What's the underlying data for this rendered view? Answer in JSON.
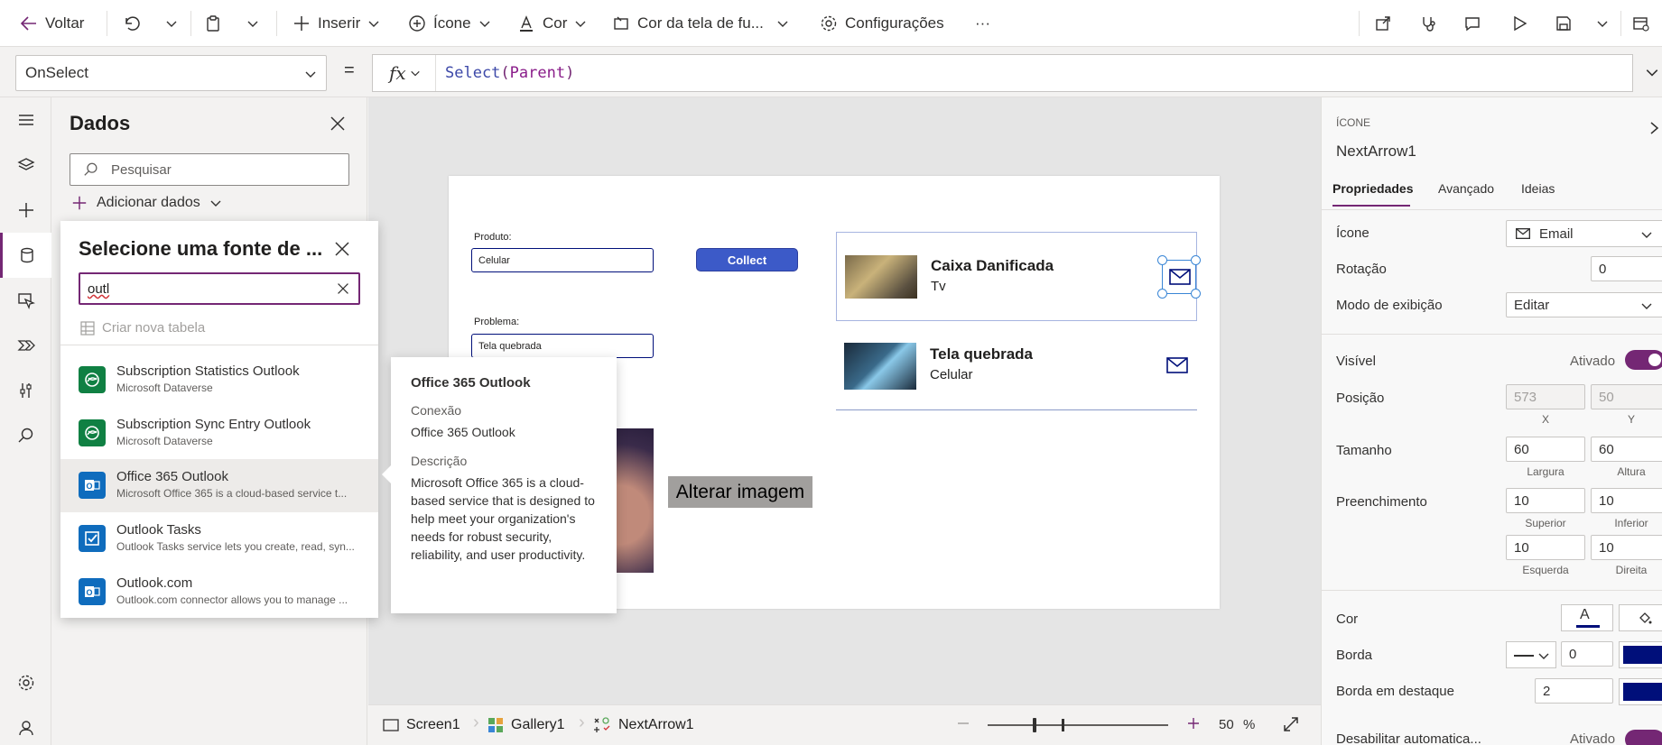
{
  "toolbar": {
    "back": "Voltar",
    "insert": "Inserir",
    "icon": "Ícone",
    "color": "Cor",
    "background": "Cor da tela de fu...",
    "settings": "Configurações",
    "more": "···"
  },
  "formula": {
    "property": "OnSelect",
    "equals": "=",
    "fx": "fx",
    "func": "Select",
    "paren_open": "(",
    "arg": "Parent",
    "paren_close": ")"
  },
  "data_panel": {
    "title": "Dados",
    "search_placeholder": "Pesquisar",
    "add_data": "Adicionar dados"
  },
  "flyout": {
    "title": "Selecione uma fonte de ...",
    "search_value": "outl",
    "create_table": "Criar nova tabela",
    "sources": [
      {
        "name": "Subscription Statistics Outlook",
        "desc": "Microsoft Dataverse"
      },
      {
        "name": "Subscription Sync Entry Outlook",
        "desc": "Microsoft Dataverse"
      },
      {
        "name": "Office 365 Outlook",
        "desc": "Microsoft Office 365 is a cloud-based service t..."
      },
      {
        "name": "Outlook Tasks",
        "desc": "Outlook Tasks service lets you create, read, syn..."
      },
      {
        "name": "Outlook.com",
        "desc": "Outlook.com connector allows you to manage ..."
      }
    ]
  },
  "tooltip": {
    "title": "Office 365 Outlook",
    "connection_label": "Conexão",
    "connection_value": "Office 365 Outlook",
    "description_label": "Descrição",
    "description_value": "Microsoft Office 365 is a cloud-based service that is designed to help meet your organization's needs for robust security, reliability, and user productivity."
  },
  "app": {
    "product_label": "Produto:",
    "product_value": "Celular",
    "collect_button": "Collect",
    "problem_label": "Problema:",
    "problem_value": "Tela quebrada",
    "change_image": "Alterar imagem",
    "gallery": [
      {
        "title": "Caixa Danificada",
        "subtitle": "Tv"
      },
      {
        "title": "Tela quebrada",
        "subtitle": "Celular"
      }
    ]
  },
  "right_panel": {
    "type": "ÍCONE",
    "name": "NextArrow1",
    "tabs": [
      "Propriedades",
      "Avançado",
      "Ideias"
    ],
    "icon_label": "Ícone",
    "icon_value": "Email",
    "rotation_label": "Rotação",
    "rotation_value": "0",
    "display_mode_label": "Modo de exibição",
    "display_mode_value": "Editar",
    "visible_label": "Visível",
    "visible_state": "Ativado",
    "position_label": "Posição",
    "pos_x": "573",
    "pos_y": "50",
    "x_label": "X",
    "y_label": "Y",
    "size_label": "Tamanho",
    "width": "60",
    "height": "60",
    "width_label": "Largura",
    "height_label": "Altura",
    "padding_label": "Preenchimento",
    "pad_top": "10",
    "pad_bottom": "10",
    "top_label": "Superior",
    "bottom_label": "Inferior",
    "pad_left": "10",
    "pad_right": "10",
    "left_label": "Esquerda",
    "right_label": "Direita",
    "color_label": "Cor",
    "border_label": "Borda",
    "border_value": "0",
    "focus_border_label": "Borda em destaque",
    "focus_border_value": "2",
    "auto_disable_label": "Desabilitar automatica...",
    "auto_disable_state": "Ativado",
    "colors": {
      "accent": "#742774",
      "navy": "#000f7a"
    }
  },
  "bottombar": {
    "screen": "Screen1",
    "gallery": "Gallery1",
    "control": "NextArrow1",
    "zoom": "50",
    "zoom_unit": "%"
  }
}
